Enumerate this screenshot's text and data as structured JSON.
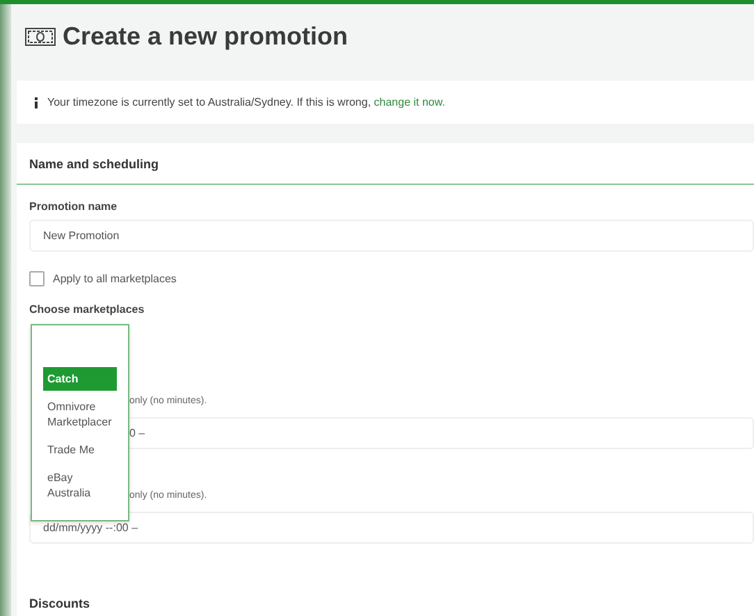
{
  "page": {
    "title": "Create a new promotion"
  },
  "notice": {
    "text": "Your timezone is currently set to Australia/Sydney. If this is wrong, ",
    "link": "change it now."
  },
  "section": {
    "title": "Name and scheduling"
  },
  "promotion_name": {
    "label": "Promotion name",
    "value": "New Promotion"
  },
  "apply_all": {
    "label": "Apply to all marketplaces",
    "checked": false
  },
  "marketplaces": {
    "label": "Choose marketplaces",
    "options": [
      {
        "label": "Catch",
        "selected": true
      },
      {
        "label": "Omnivore Marketplacer",
        "selected": false
      },
      {
        "label": "Trade Me",
        "selected": false
      },
      {
        "label": "eBay Australia",
        "selected": false
      }
    ]
  },
  "date_fields": [
    {
      "hint": "only (no minutes).",
      "value": "0 –"
    },
    {
      "hint": "only (no minutes).",
      "value": "dd/mm/yyyy --:00 –"
    }
  ],
  "discounts": {
    "title": "Discounts"
  }
}
